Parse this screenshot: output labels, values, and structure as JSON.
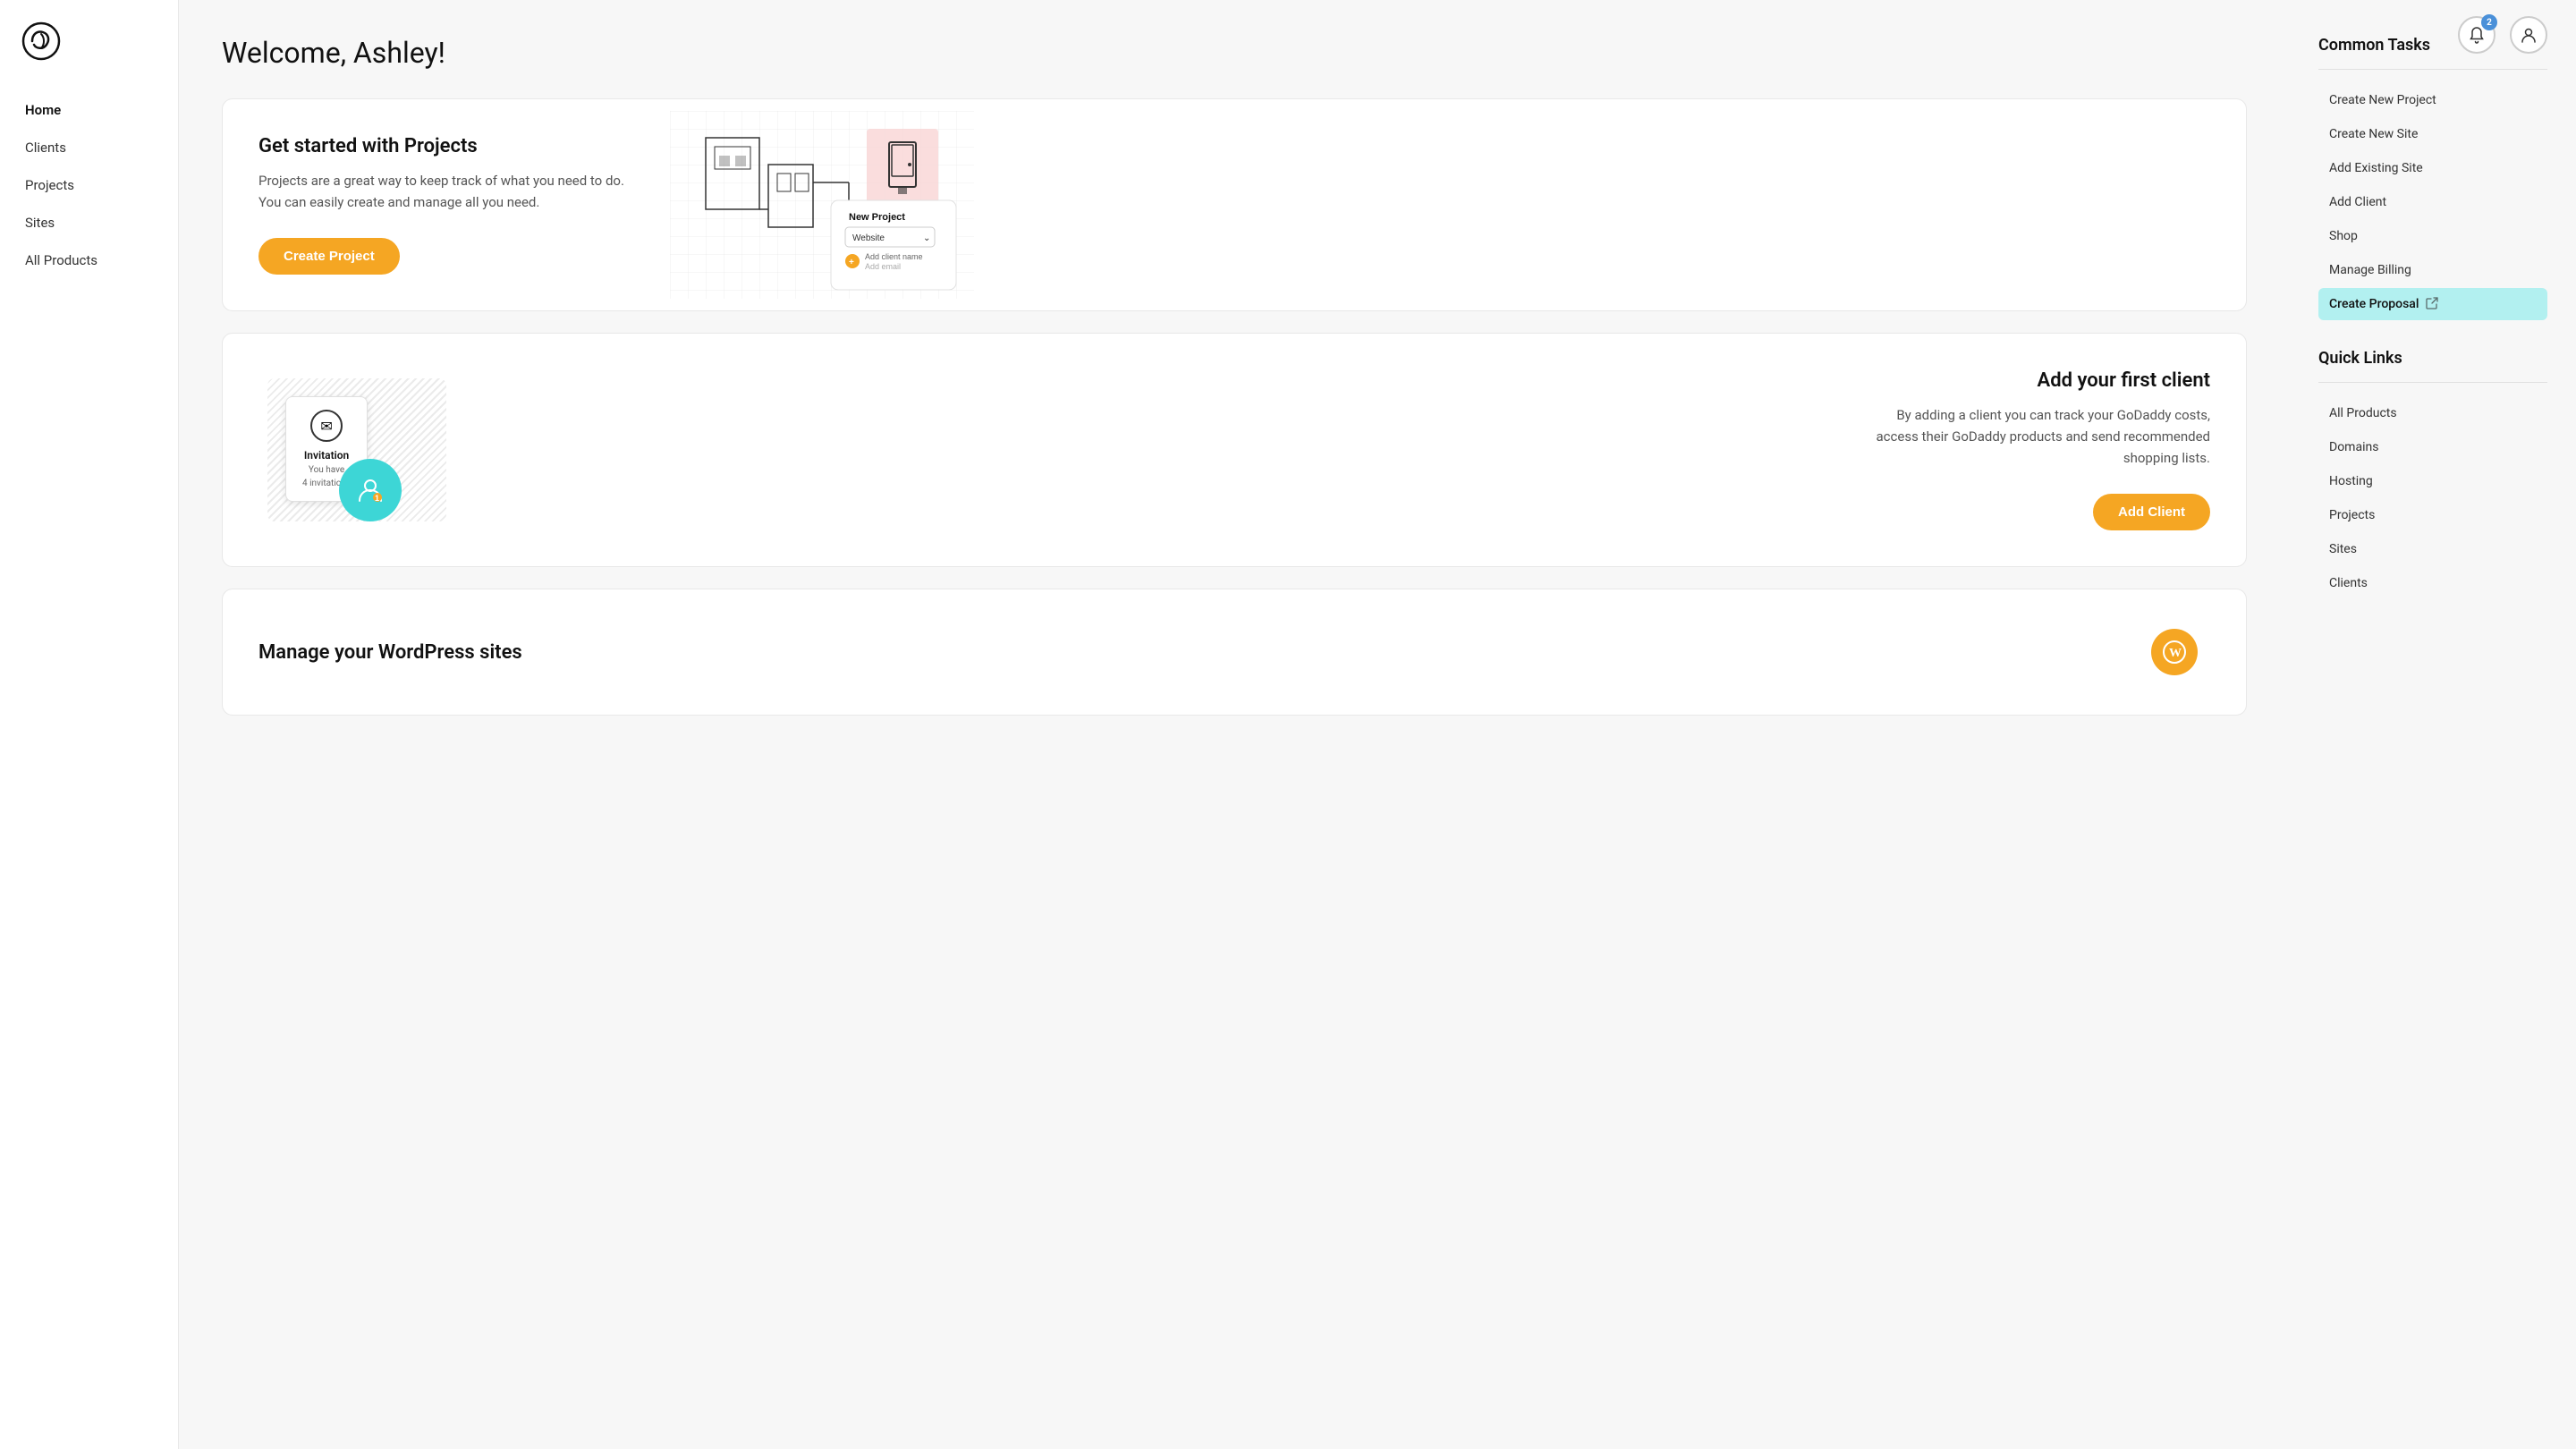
{
  "page": {
    "title": "Welcome, Ashley!"
  },
  "sidebar": {
    "logo_alt": "GoDaddy Pro logo",
    "items": [
      {
        "label": "Home",
        "active": true,
        "id": "home"
      },
      {
        "label": "Clients",
        "active": false,
        "id": "clients"
      },
      {
        "label": "Projects",
        "active": false,
        "id": "projects"
      },
      {
        "label": "Sites",
        "active": false,
        "id": "sites"
      },
      {
        "label": "All Products",
        "active": false,
        "id": "all-products"
      }
    ]
  },
  "cards": {
    "projects": {
      "title": "Get started with Projects",
      "description": "Projects are a great way to keep track of what you need to do. You can easily create and manage all you need.",
      "button_label": "Create Project"
    },
    "clients": {
      "title": "Add your first client",
      "description": "By adding a client you can track your GoDaddy costs, access their GoDaddy products and send recommended shopping lists.",
      "button_label": "Add Client",
      "invitation_title": "Invitation",
      "invitation_sub1": "You have",
      "invitation_sub2": "4 invitations"
    },
    "wordpress": {
      "title": "Manage your WordPress sites"
    }
  },
  "header": {
    "notification_count": "2"
  },
  "right_panel": {
    "common_tasks": {
      "section_title": "Common Tasks",
      "items": [
        {
          "label": "Create New Project",
          "id": "create-new-project",
          "highlighted": false,
          "external": false
        },
        {
          "label": "Create New Site",
          "id": "create-new-site",
          "highlighted": false,
          "external": false
        },
        {
          "label": "Add Existing Site",
          "id": "add-existing-site",
          "highlighted": false,
          "external": false
        },
        {
          "label": "Add Client",
          "id": "add-client",
          "highlighted": false,
          "external": false
        },
        {
          "label": "Shop",
          "id": "shop",
          "highlighted": false,
          "external": false
        },
        {
          "label": "Manage Billing",
          "id": "manage-billing",
          "highlighted": false,
          "external": false
        },
        {
          "label": "Create Proposal",
          "id": "create-proposal",
          "highlighted": true,
          "external": true
        }
      ]
    },
    "quick_links": {
      "section_title": "Quick Links",
      "items": [
        {
          "label": "All Products",
          "id": "ql-all-products"
        },
        {
          "label": "Domains",
          "id": "ql-domains"
        },
        {
          "label": "Hosting",
          "id": "ql-hosting"
        },
        {
          "label": "Projects",
          "id": "ql-projects"
        },
        {
          "label": "Sites",
          "id": "ql-sites"
        },
        {
          "label": "Clients",
          "id": "ql-clients"
        }
      ]
    }
  }
}
